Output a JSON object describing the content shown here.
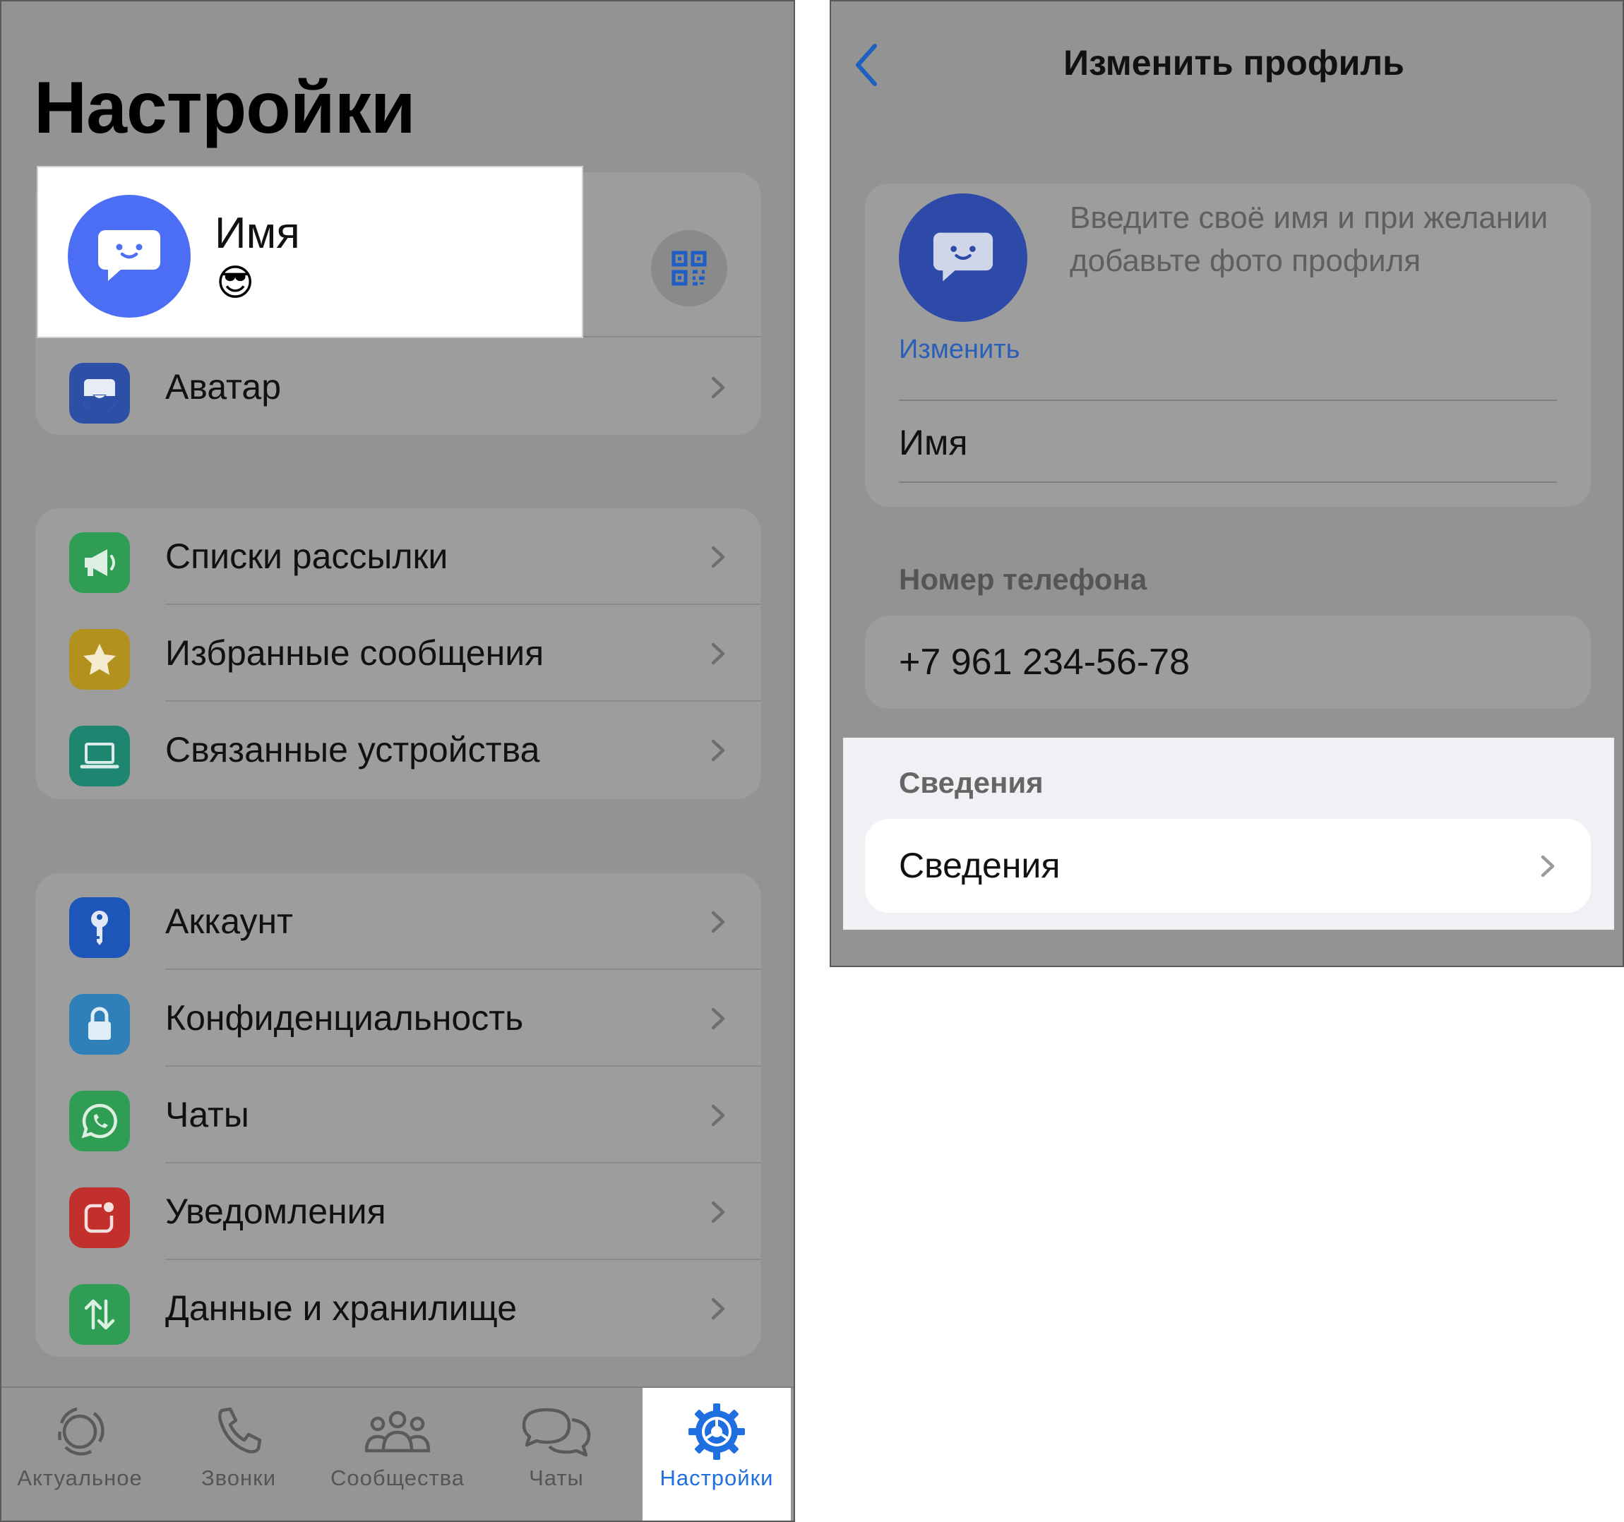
{
  "settings": {
    "title": "Настройки",
    "profile": {
      "name": "Имя",
      "status_emoji": "😎"
    },
    "avatar_row": {
      "label": "Аватар",
      "icon": "avatar-icon",
      "color": "#2d4fa6"
    },
    "group1": [
      {
        "label": "Списки рассылки",
        "icon": "megaphone-icon",
        "color": "#2f9e54"
      },
      {
        "label": "Избранные сообщения",
        "icon": "star-icon",
        "color": "#b3911f"
      },
      {
        "label": "Связанные устройства",
        "icon": "laptop-icon",
        "color": "#1e8571"
      }
    ],
    "group2": [
      {
        "label": "Аккаунт",
        "icon": "key-icon",
        "color": "#1d56b8"
      },
      {
        "label": "Конфиденциальность",
        "icon": "lock-icon",
        "color": "#2f7fb8"
      },
      {
        "label": "Чаты",
        "icon": "whatsapp-icon",
        "color": "#2f9e54"
      },
      {
        "label": "Уведомления",
        "icon": "notification-icon",
        "color": "#c2302e"
      },
      {
        "label": "Данные и хранилище",
        "icon": "arrows-icon",
        "color": "#2f9e54"
      }
    ]
  },
  "tabbar": [
    {
      "label": "Актуальное",
      "icon": "updates-icon"
    },
    {
      "label": "Звонки",
      "icon": "phone-icon"
    },
    {
      "label": "Сообщества",
      "icon": "communities-icon"
    },
    {
      "label": "Чаты",
      "icon": "chats-icon"
    },
    {
      "label": "Настройки",
      "icon": "settings-gear-icon",
      "active": true
    }
  ],
  "edit_profile": {
    "title": "Изменить профиль",
    "edit_link": "Изменить",
    "hint": "Введите своё имя и при желании добавьте фото профиля",
    "name": "Имя",
    "phone_section": "Номер телефона",
    "phone": "+7 961 234-56-78",
    "about_section": "Сведения",
    "about_row": "Сведения"
  },
  "colors": {
    "accent": "#1f6fe0",
    "dim_bg": "#939393",
    "avatar_blue": "#4c6ef5"
  }
}
